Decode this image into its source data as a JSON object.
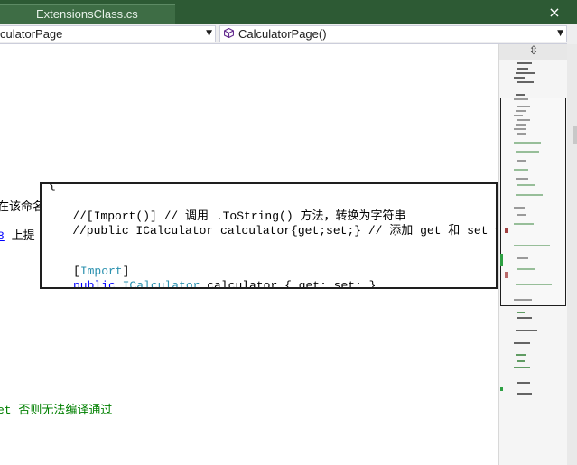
{
  "tab": {
    "title": "ExtensionsClass.cs",
    "close_glyph": "×"
  },
  "navbar": {
    "type_combo": "culatorPage",
    "member_combo": "CalculatorPage()",
    "member_icon": "method-cube-icon",
    "dropdown_glyph": "▼"
  },
  "editor": {
    "line_partial_1": "在该命名",
    "line_partial_2_link": "8",
    "line_partial_2_text": " 上提",
    "line_partial_3": "et 否则无法编译通过"
  },
  "peek": {
    "line1": "{",
    "line2": "    //[Import()] // 调用 .ToString() 方法，转换为字符串",
    "line3": "    //public ICalculator calculator{get;set;} // 添加 get 和 set 否则无",
    "line4_import": "[Import]",
    "line5_public": "public",
    "line5_type": "ICalculator",
    "line5_rest": " calculator { get; set; }"
  },
  "map": {
    "header_glyph": "⇳"
  },
  "colors": {
    "tab_bar": "#2d5a34",
    "comment": "#008000",
    "keyword": "#0000ff",
    "type": "#2b91af",
    "minimap_marker_red": "#a04040",
    "minimap_marker_green": "#2ea043"
  }
}
